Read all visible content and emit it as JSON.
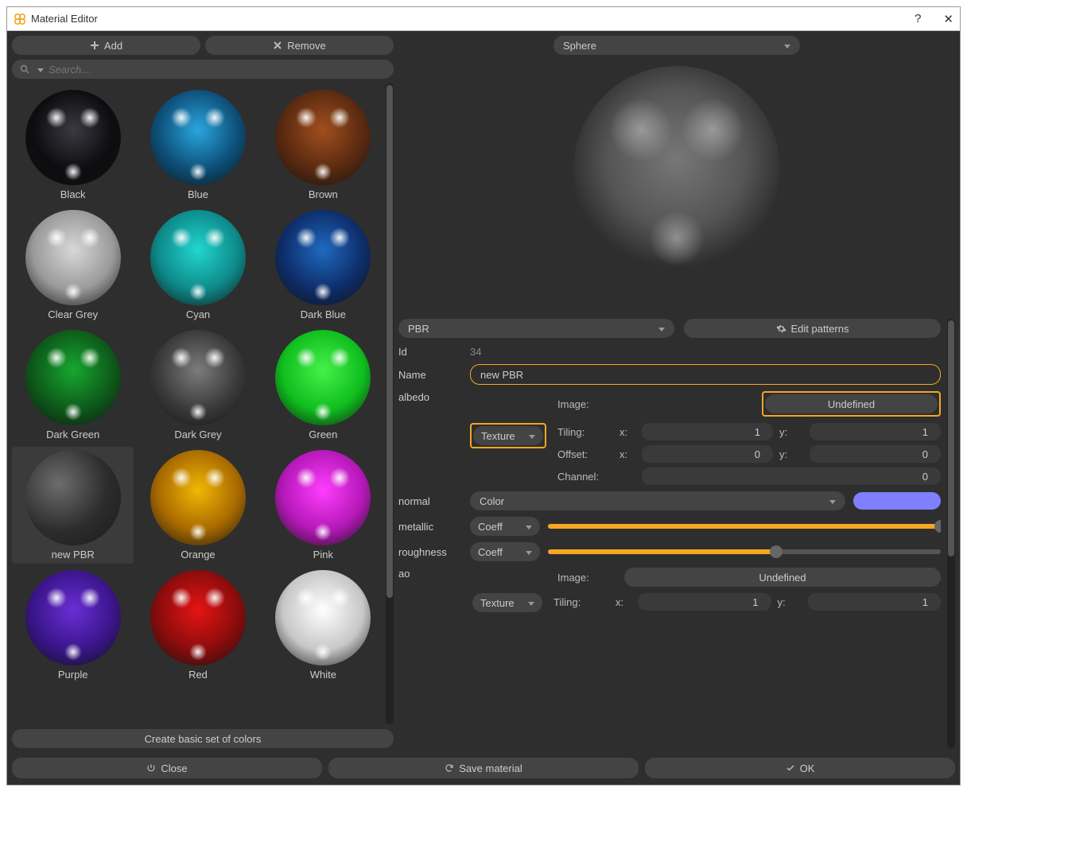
{
  "window": {
    "title": "Material Editor",
    "help": "?",
    "close": "✕"
  },
  "toolbar": {
    "add": "Add",
    "remove": "Remove"
  },
  "search": {
    "placeholder": "Search..."
  },
  "materials": [
    {
      "name": "Black",
      "base": "#0d0d10",
      "light": "#3a3a42"
    },
    {
      "name": "Blue",
      "base": "#0d4f78",
      "light": "#2aa6e0"
    },
    {
      "name": "Brown",
      "base": "#5a2a10",
      "light": "#a14f1f"
    },
    {
      "name": "Clear Grey",
      "base": "#9a9a9a",
      "light": "#d8d8d8"
    },
    {
      "name": "Cyan",
      "base": "#0e8a8a",
      "light": "#22d6d0"
    },
    {
      "name": "Dark Blue",
      "base": "#0e2d6a",
      "light": "#1f6ac0"
    },
    {
      "name": "Dark Green",
      "base": "#0d5a1a",
      "light": "#17a82e"
    },
    {
      "name": "Dark Grey",
      "base": "#3a3a3a",
      "light": "#7c7c7c"
    },
    {
      "name": "Green",
      "base": "#0fbf1e",
      "light": "#46f04a"
    },
    {
      "name": "new PBR",
      "base": "#2c2c2c",
      "light": "#6d6d6d",
      "selected": true,
      "rough": true
    },
    {
      "name": "Orange",
      "base": "#a86a00",
      "light": "#f2b705"
    },
    {
      "name": "Pink",
      "base": "#b518b8",
      "light": "#ff3dff"
    },
    {
      "name": "Purple",
      "base": "#3a158a",
      "light": "#6a2ed6"
    },
    {
      "name": "Red",
      "base": "#8a0c0c",
      "light": "#e61414"
    },
    {
      "name": "White",
      "base": "#c7c7c7",
      "light": "#ffffff"
    }
  ],
  "createColors": "Create basic set of colors",
  "preview": {
    "shape": "Sphere"
  },
  "typeSelect": "PBR",
  "editPatterns": "Edit patterns",
  "form": {
    "idLabel": "Id",
    "idValue": "34",
    "nameLabel": "Name",
    "nameValue": "new PBR",
    "albedoLabel": "albedo",
    "textureLabel": "Texture",
    "imageLabel": "Image:",
    "undefined": "Undefined",
    "tilingLabel": "Tiling:",
    "offsetLabel": "Offset:",
    "channelLabel": "Channel:",
    "xLabel": "x:",
    "yLabel": "y:",
    "tilingX": "1",
    "tilingY": "1",
    "offsetX": "0",
    "offsetY": "0",
    "channel": "0",
    "normalLabel": "normal",
    "normalMode": "Color",
    "normalColor": "#7f7fff",
    "metallicLabel": "metallic",
    "metallicMode": "Coeff",
    "metallicValue": 1.0,
    "roughnessLabel": "roughness",
    "roughnessMode": "Coeff",
    "roughnessValue": 0.58,
    "aoLabel": "ao",
    "aoTilingX": "1",
    "aoTilingY": "1"
  },
  "footer": {
    "close": "Close",
    "save": "Save material",
    "ok": "OK"
  }
}
